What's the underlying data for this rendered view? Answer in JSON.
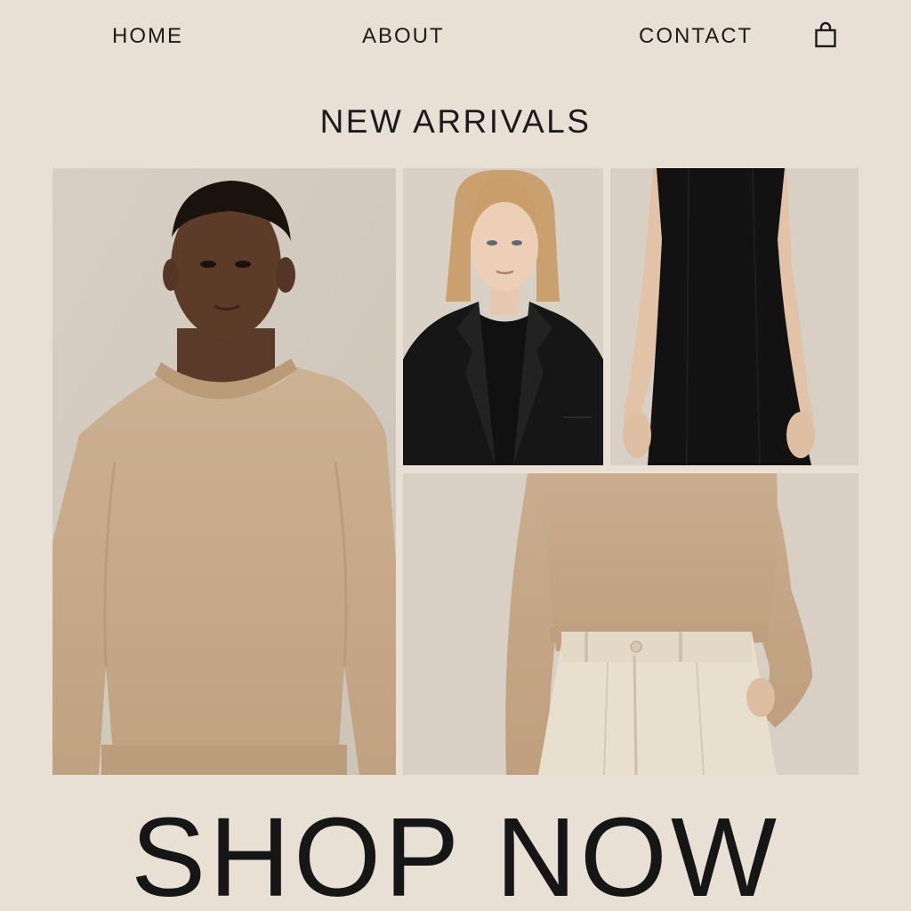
{
  "nav": {
    "home": "HOME",
    "about": "ABOUT",
    "contact": "CONTACT",
    "cart_icon": "shopping-bag-icon"
  },
  "section": {
    "title": "NEW ARRIVALS"
  },
  "products": [
    {
      "image": "man-beige-sweater-photo"
    },
    {
      "image": "woman-black-blazer-photo"
    },
    {
      "image": "black-slip-dress-photo"
    },
    {
      "image": "beige-sweater-cream-trousers-photo"
    }
  ],
  "cta": {
    "label": "SHOP NOW"
  },
  "colors": {
    "background": "#e9e0d5",
    "text": "#1b1b1b",
    "beige_knit": "#c8ad8e",
    "black_garment": "#141414",
    "cream_trouser": "#e9dfcf"
  }
}
